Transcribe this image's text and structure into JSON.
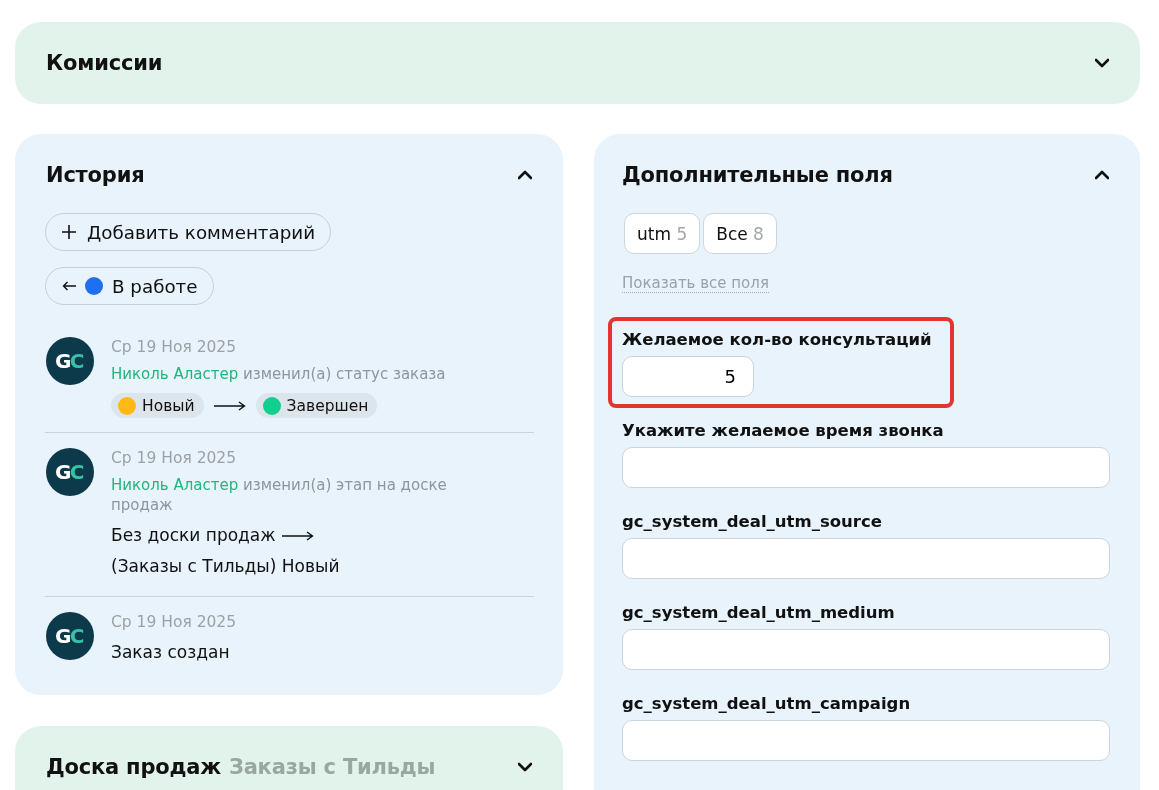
{
  "commissions": {
    "title": "Комиссии",
    "expanded": false
  },
  "history": {
    "title": "История",
    "expanded": true,
    "add_comment_button": {
      "label": "Добавить комментарий"
    },
    "status_button": {
      "label": "В работе",
      "color": "#1f6ff2"
    },
    "entries": [
      {
        "kind": "status",
        "avatar": "GC",
        "date": "Ср 19 Ноя 2025",
        "author": "Николь Аластер",
        "action": "изменил(а) статус заказа",
        "from": {
          "label": "Новый",
          "color": "#ffb915"
        },
        "to": {
          "label": "Завершен",
          "color": "#12cf8d"
        }
      },
      {
        "kind": "stage",
        "avatar": "GC",
        "date": "Ср 19 Ноя 2025",
        "author": "Николь Аластер",
        "action": "изменил(а) этап на доске продаж",
        "from_stage": "Без доски продаж",
        "to_stage": "(Заказы с Тильды) Новый"
      },
      {
        "kind": "note",
        "avatar": "GC",
        "date": "Ср 19 Ноя 2025",
        "text": "Заказ создан"
      }
    ]
  },
  "sales_board": {
    "title": "Доска продаж",
    "board": "Заказы с Тильды",
    "expanded": false
  },
  "extra_fields": {
    "title": "Дополнительные поля",
    "expanded": true,
    "tabs": [
      {
        "label": "utm",
        "count": "5",
        "selected": false
      },
      {
        "label": "Все",
        "count": "8",
        "selected": false
      }
    ],
    "show_all_link": "Показать все поля",
    "fields": [
      {
        "kind": "number",
        "label": "Желаемое кол-во консультаций",
        "value": "5",
        "highlighted": true
      },
      {
        "kind": "text",
        "label": "Укажите желаемое время звонка",
        "highlighted": false
      },
      {
        "kind": "text",
        "label": "gc_system_deal_utm_source",
        "highlighted": false
      },
      {
        "kind": "text",
        "label": "gc_system_deal_utm_medium",
        "highlighted": false
      },
      {
        "kind": "text",
        "label": "gc_system_deal_utm_campaign",
        "highlighted": false
      }
    ]
  }
}
